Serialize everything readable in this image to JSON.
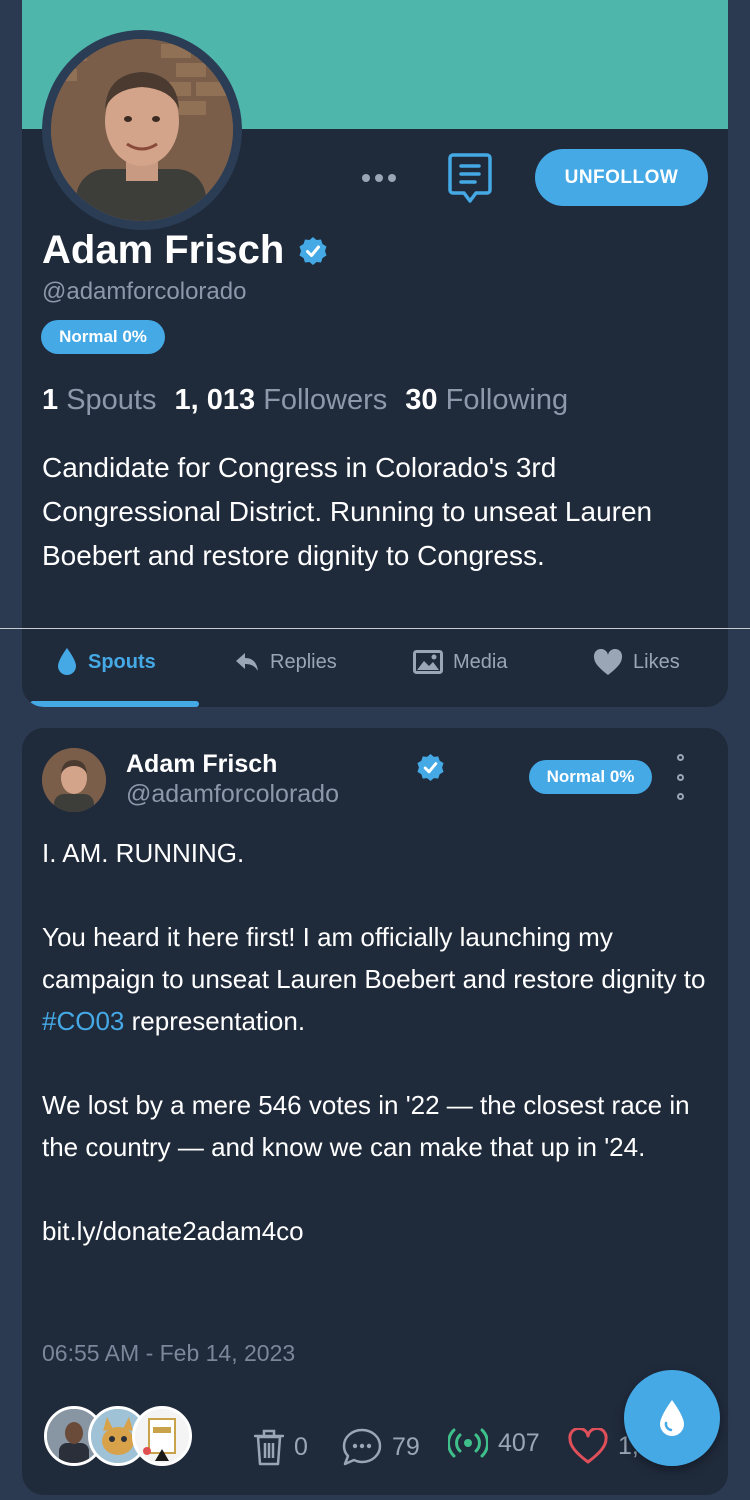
{
  "profile": {
    "name": "Adam Frisch",
    "handle": "@adamforcolorado",
    "badge": "Normal 0%",
    "stats": {
      "spouts_count": "1",
      "spouts_label": "Spouts",
      "followers_count": "1, 013",
      "followers_label": "Followers",
      "following_count": "30",
      "following_label": "Following"
    },
    "bio": "Candidate for Congress in Colorado's 3rd Congressional District. Running to unseat Lauren Boebert and restore dignity to Congress.",
    "unfollow_label": "UNFOLLOW",
    "banner_color": "#4fb6ab"
  },
  "tabs": [
    {
      "label": "Spouts",
      "icon": "drop-icon",
      "active": true
    },
    {
      "label": "Replies",
      "icon": "reply-arrow-icon",
      "active": false
    },
    {
      "label": "Media",
      "icon": "image-icon",
      "active": false
    },
    {
      "label": "Likes",
      "icon": "heart-icon",
      "active": false
    }
  ],
  "post": {
    "author_name": "Adam Frisch",
    "author_handle": "@adamforcolorado",
    "badge": "Normal 0%",
    "body": {
      "line1": "I. AM. RUNNING.",
      "para2_before": "You heard it here first! I am officially launching my campaign to unseat Lauren Boebert and restore dignity to ",
      "hashtag": "#CO03",
      "para2_after": " representation.",
      "para3": "We lost by a mere 546 votes in '22 — the closest race in the country — and know we can make that up in '24.",
      "link": "bit.ly/donate2adam4co"
    },
    "timestamp": "06:55 AM - Feb 14, 2023",
    "actions": {
      "delete_count": "0",
      "comments_count": "79",
      "respouts_count": "407",
      "likes_count": "1,"
    }
  },
  "colors": {
    "accent": "#45a9e6",
    "background": "#2b3a50",
    "card": "#1f2a3b",
    "respout_green": "#3fbf8a",
    "like_red": "#e0505a"
  }
}
